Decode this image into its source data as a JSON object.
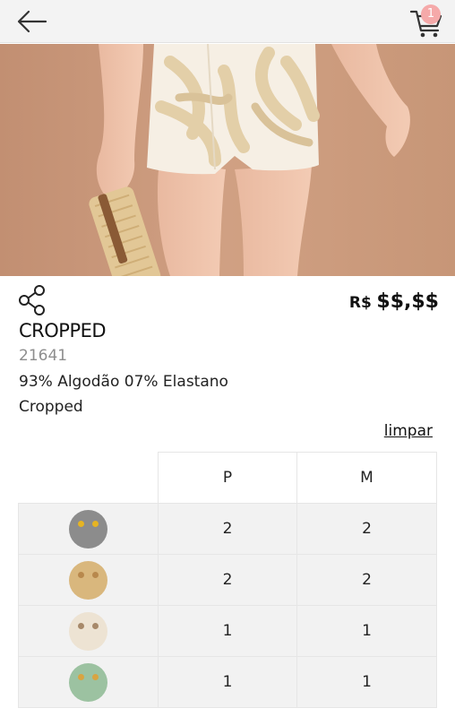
{
  "header": {
    "back_icon": "arrow-left-icon",
    "cart_icon": "cart-icon",
    "cart_count": "1"
  },
  "gallery": {
    "slide_count": 3,
    "active_slide": 1
  },
  "product": {
    "share_icon": "share-icon",
    "currency": "R$",
    "price": "$$,$$",
    "title": "CROPPED",
    "code": "21641",
    "composition": "93% Algodão 07% Elastano",
    "category": "Cropped"
  },
  "grid": {
    "clear_label": "limpar",
    "sizes": [
      "P",
      "M"
    ],
    "rows": [
      {
        "color": "#8c8c8c",
        "accent": "#e6b422",
        "quantities": [
          "2",
          "2"
        ]
      },
      {
        "color": "#d9b77d",
        "accent": "#b8884c",
        "quantities": [
          "2",
          "2"
        ]
      },
      {
        "color": "#ede3d3",
        "accent": "#a7896a",
        "quantities": [
          "1",
          "1"
        ]
      },
      {
        "color": "#9cc2a1",
        "accent": "#d9a441",
        "quantities": [
          "1",
          "1"
        ]
      }
    ]
  }
}
